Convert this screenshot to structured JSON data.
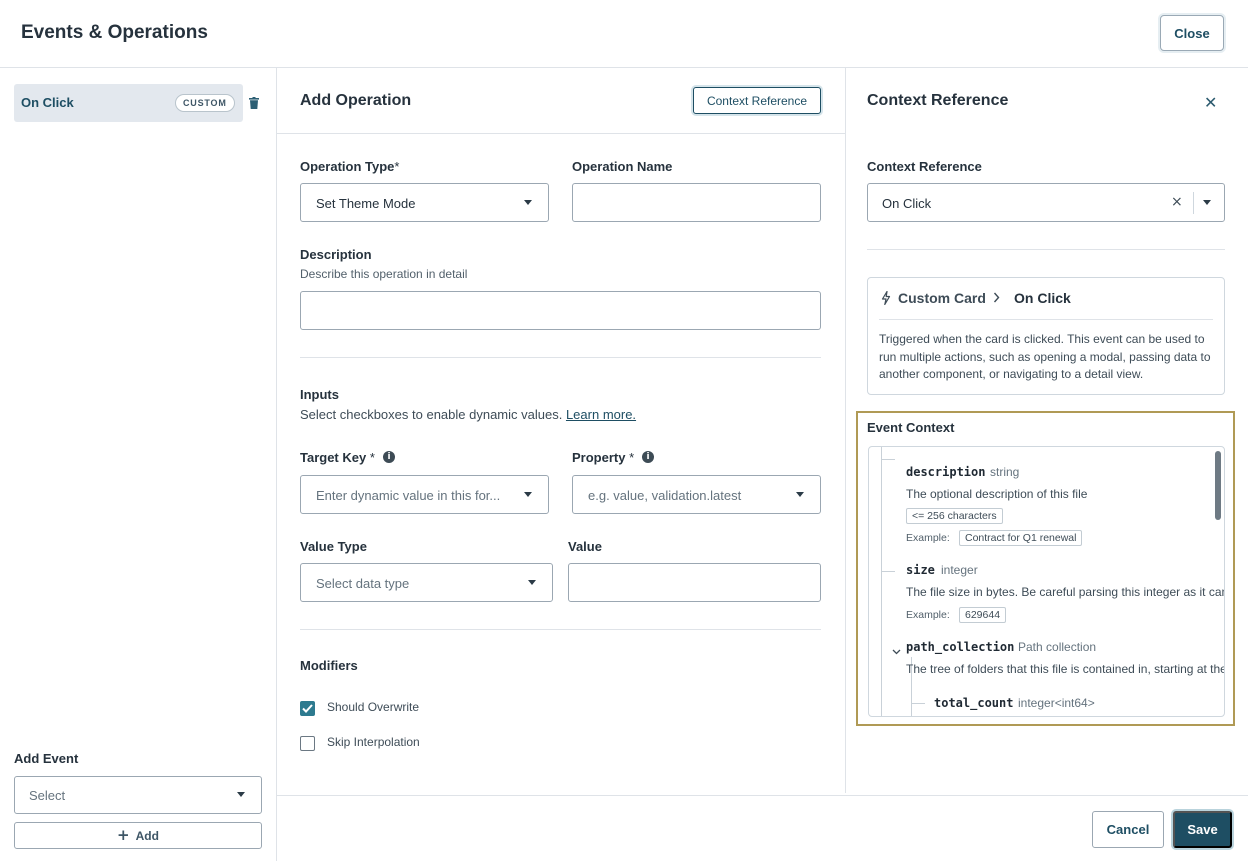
{
  "header": {
    "title": "Events & Operations",
    "close_label": "Close"
  },
  "events": {
    "items": [
      {
        "label": "On Click",
        "badge": "CUSTOM"
      }
    ],
    "add_event": {
      "label": "Add Event",
      "select_placeholder": "Select",
      "add_label": "Add"
    }
  },
  "operation": {
    "title": "Add Operation",
    "context_reference_button": "Context Reference",
    "operation_type": {
      "label": "Operation Type",
      "required": "*",
      "value": "Set Theme Mode"
    },
    "operation_name": {
      "label": "Operation Name",
      "value": ""
    },
    "description": {
      "label": "Description",
      "help": "Describe this operation in detail",
      "value": ""
    },
    "inputs": {
      "label": "Inputs",
      "help": "Select checkboxes to enable dynamic values.",
      "learn_more": "Learn more."
    },
    "target_key": {
      "label": "Target Key",
      "required": "*",
      "placeholder": "Enter dynamic value in this for..."
    },
    "property": {
      "label": "Property",
      "required": "*",
      "placeholder": "e.g. value, validation.latest"
    },
    "value_type": {
      "label": "Value Type",
      "placeholder": "Select data type"
    },
    "value": {
      "label": "Value",
      "value": ""
    },
    "modifiers": {
      "label": "Modifiers",
      "items": [
        {
          "label": "Should Overwrite",
          "checked": true
        },
        {
          "label": "Skip Interpolation",
          "checked": false
        }
      ]
    }
  },
  "context_panel": {
    "title": "Context Reference",
    "field_label": "Context Reference",
    "selected": "On Click",
    "breadcrumb": {
      "parent": "Custom Card",
      "current": "On Click",
      "description": "Triggered when the card is clicked. This event can be used to run multiple actions, such as opening a modal, passing data to another component, or navigating to a detail view."
    },
    "event_context": {
      "label": "Event Context",
      "example_label": "Example:",
      "properties": [
        {
          "name": "description",
          "type": "string",
          "desc": "The optional description of this file",
          "constraint": "<= 256 characters",
          "example": "Contract for Q1 renewal"
        },
        {
          "name": "size",
          "type": "integer",
          "desc": "The file size in bytes. Be careful parsing this integer as it can",
          "example": "629644"
        },
        {
          "name": "path_collection",
          "type": "Path collection",
          "desc": "The tree of folders that this file is contained in, starting at the root"
        },
        {
          "name": "total_count",
          "type": "integer<int64>"
        }
      ]
    }
  },
  "footer": {
    "cancel_label": "Cancel",
    "save_label": "Save"
  },
  "colors": {
    "primary": "#1e4e63",
    "checkbox_checked": "#2d7a8f",
    "highlight_frame": "#b09a55"
  }
}
